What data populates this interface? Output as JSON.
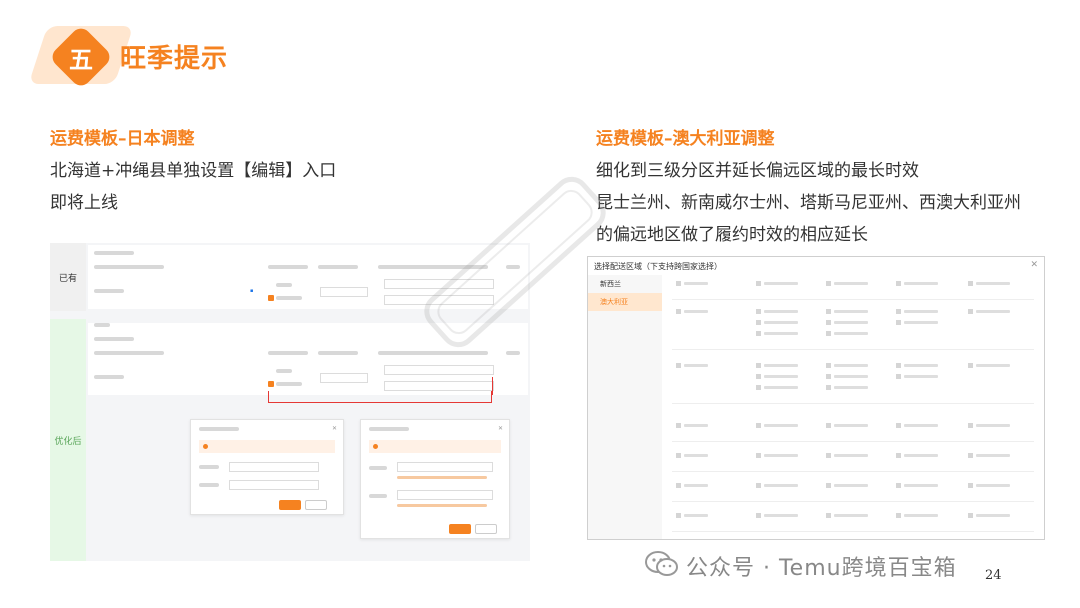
{
  "section": {
    "number": "五",
    "title": "旺季提示"
  },
  "left": {
    "subtitle": "运费模板–日本调整",
    "lines": [
      "北海道+冲绳县单独设置【编辑】入口",
      "即将上线"
    ],
    "screenshot": {
      "label_existing": "已有",
      "label_optimized": "优化后"
    }
  },
  "right": {
    "subtitle": "运费模板–澳大利亚调整",
    "lines": [
      "细化到三级分区并延长偏远区域的最长时效",
      "昆士兰州、新南威尔士州、塔斯马尼亚州、西澳大利亚州",
      "的偏远地区做了履约时效的相应延长"
    ],
    "screenshot": {
      "header": "选择配送区域（下支持跨国家选择）",
      "countries": [
        "新西兰",
        "澳大利亚"
      ],
      "selected_country": "澳大利亚"
    }
  },
  "footer": {
    "account": "公众号 · Temu跨境百宝箱",
    "page": "24"
  },
  "colors": {
    "accent": "#f58220",
    "green_label": "#5aa65a",
    "red_arrow": "#e53935"
  }
}
